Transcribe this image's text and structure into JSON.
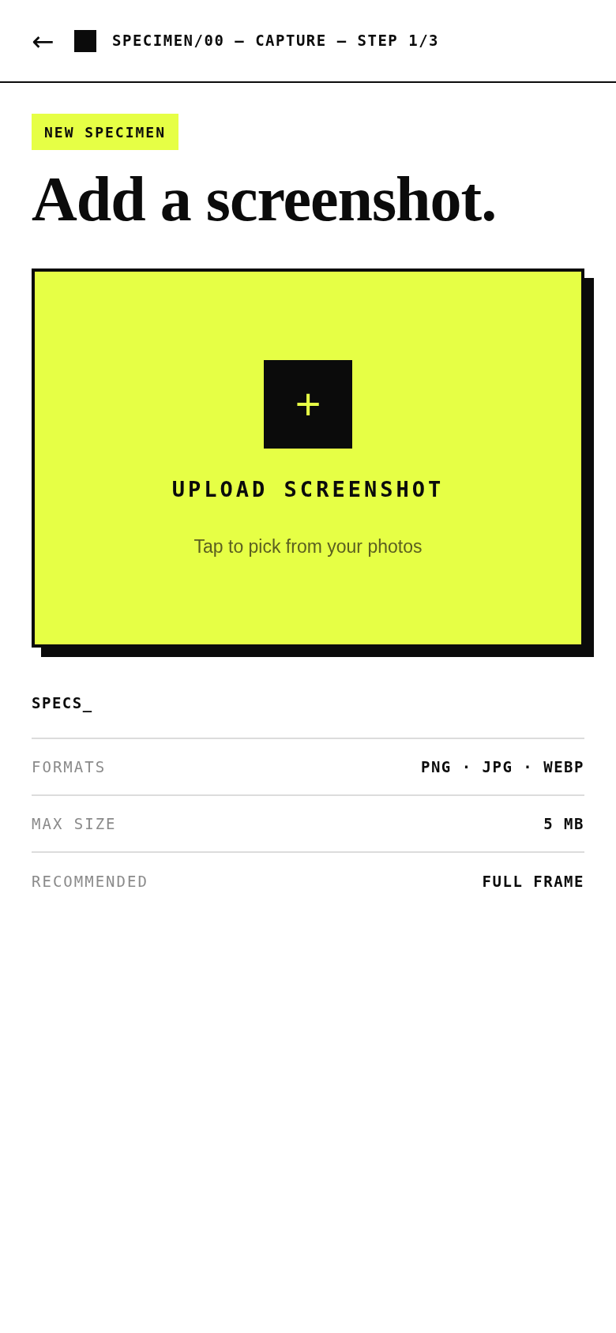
{
  "header": {
    "back_glyph": "←",
    "breadcrumb": "SPECIMEN/00 — CAPTURE — STEP 1/3"
  },
  "badge": "NEW SPECIMEN",
  "heading": "Add a screenshot.",
  "upload": {
    "plus_glyph": "+",
    "label": "UPLOAD SCREENSHOT",
    "hint": "Tap to pick from your photos"
  },
  "specs": {
    "title": "SPECS_",
    "rows": [
      {
        "label": "FORMATS",
        "value": "PNG · JPG · WEBP"
      },
      {
        "label": "MAX SIZE",
        "value": "5 MB"
      },
      {
        "label": "RECOMMENDED",
        "value": "FULL FRAME"
      }
    ]
  }
}
